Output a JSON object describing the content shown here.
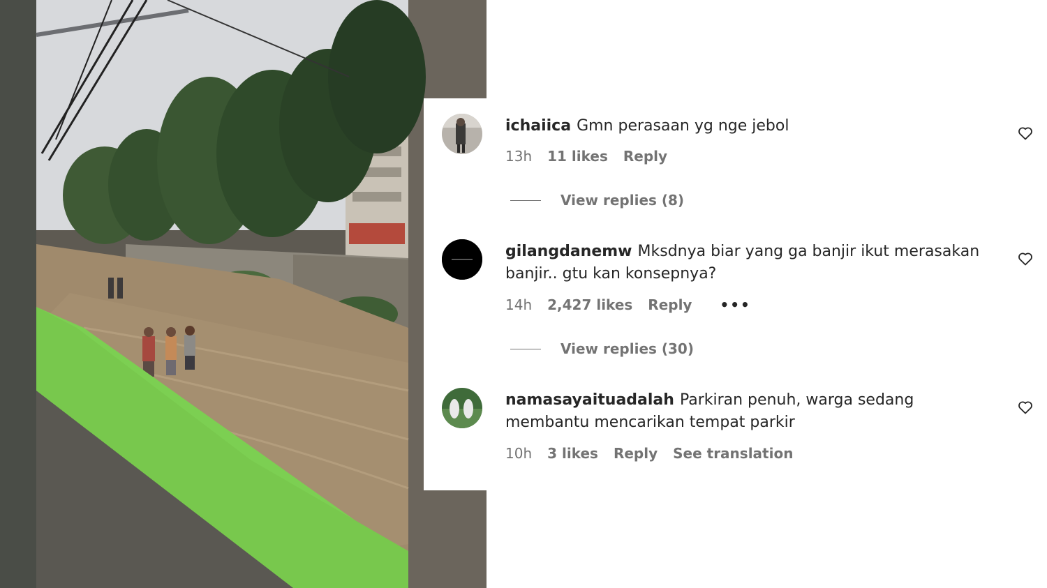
{
  "comments": [
    {
      "username": "ichaiica",
      "text": "Gmn perasaan yg nge jebol",
      "time": "13h",
      "likes": "11 likes",
      "reply": "Reply",
      "view_replies": "View replies (8)"
    },
    {
      "username": "gilangdanemw",
      "text": "Mksdnya biar yang ga banjir ikut merasakan banjir.. gtu kan konsepnya?",
      "time": "14h",
      "likes": "2,427 likes",
      "reply": "Reply",
      "view_replies": "View replies (30)"
    },
    {
      "username": "namasayaituadalah",
      "text": "Parkiran penuh, warga sedang membantu mencarikan tempat parkir",
      "time": "10h",
      "likes": "3 likes",
      "reply": "Reply",
      "see_translation": "See translation"
    }
  ],
  "icons": {
    "heart": "heart-outline-icon",
    "more": "more-options-icon"
  },
  "colors": {
    "text_primary": "#262626",
    "text_secondary": "#737373",
    "background": "#ffffff"
  }
}
